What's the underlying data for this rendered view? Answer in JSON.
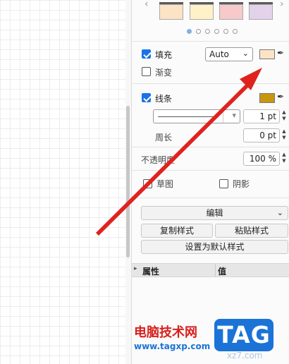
{
  "style_swatches": {
    "colors": [
      "#fde3c5",
      "#fff2c8",
      "#f7c9c9",
      "#e2d2ea"
    ],
    "page_dots": 6,
    "active_dot": 0
  },
  "fill": {
    "label": "填充",
    "checked": true,
    "mode": "Auto",
    "color": "#fde3c5",
    "gradient_label": "渐变",
    "gradient_checked": false
  },
  "line": {
    "label": "线条",
    "checked": true,
    "color": "#c8960e",
    "width_value": "1 pt",
    "perimeter_label": "周长",
    "perimeter_value": "0 pt"
  },
  "opacity": {
    "label": "不透明度",
    "value": "100 %"
  },
  "options": {
    "sketch_label": "草图",
    "sketch_checked": false,
    "shadow_label": "阴影",
    "shadow_checked": false
  },
  "actions": {
    "edit_label": "编辑",
    "copy_style_label": "复制样式",
    "paste_style_label": "粘贴样式",
    "set_default_label": "设置为默认样式"
  },
  "properties_table": {
    "col_property": "属性",
    "col_value": "值"
  },
  "watermark": {
    "site_name": "电脑技术网",
    "url": "www.tagxp.com",
    "badge": "TAG",
    "faint_text": "xz7.com"
  },
  "colors": {
    "accent": "#1a73e8",
    "arrow": "#e0221f"
  }
}
